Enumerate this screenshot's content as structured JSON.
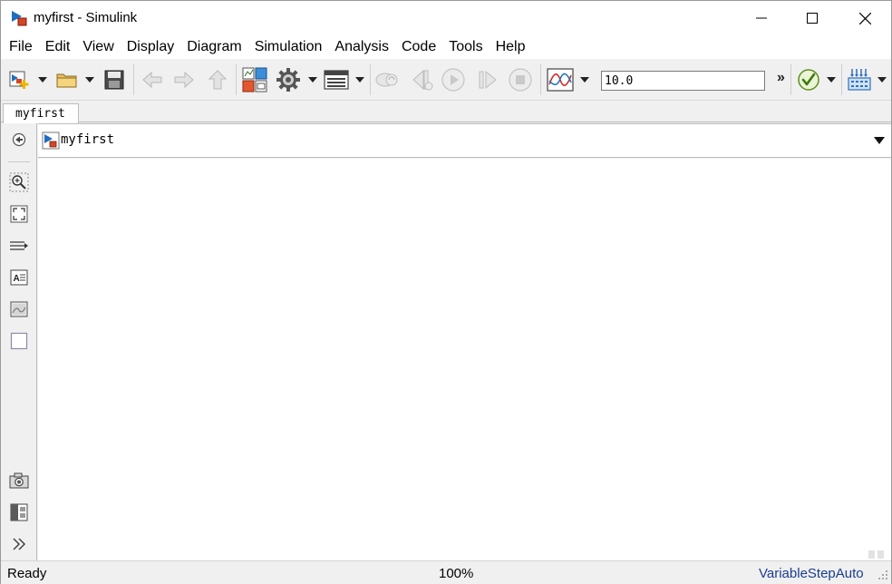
{
  "window": {
    "title": "myfirst - Simulink"
  },
  "menu": [
    "File",
    "Edit",
    "View",
    "Display",
    "Diagram",
    "Simulation",
    "Analysis",
    "Code",
    "Tools",
    "Help"
  ],
  "toolbar": {
    "stop_time": "10.0",
    "overflow": "»"
  },
  "tabs": [
    {
      "label": "myfirst"
    }
  ],
  "address": {
    "model": "myfirst"
  },
  "status": {
    "state": "Ready",
    "zoom": "100%",
    "solver": "VariableStepAuto"
  },
  "icons": {
    "new": "new-model-icon",
    "open": "open-folder-icon",
    "save": "save-icon",
    "back": "back-arrow-icon",
    "forward": "forward-arrow-icon",
    "up": "up-arrow-icon",
    "library": "library-browser-icon",
    "settings": "model-settings-gear-icon",
    "explorer": "model-explorer-icon",
    "record": "record-step-icon",
    "step_back": "step-back-icon",
    "run": "run-icon",
    "step_forward": "step-forward-icon",
    "stop": "stop-icon",
    "data_inspector": "data-inspector-icon",
    "check": "model-advisor-check-icon",
    "build": "build-icon"
  }
}
